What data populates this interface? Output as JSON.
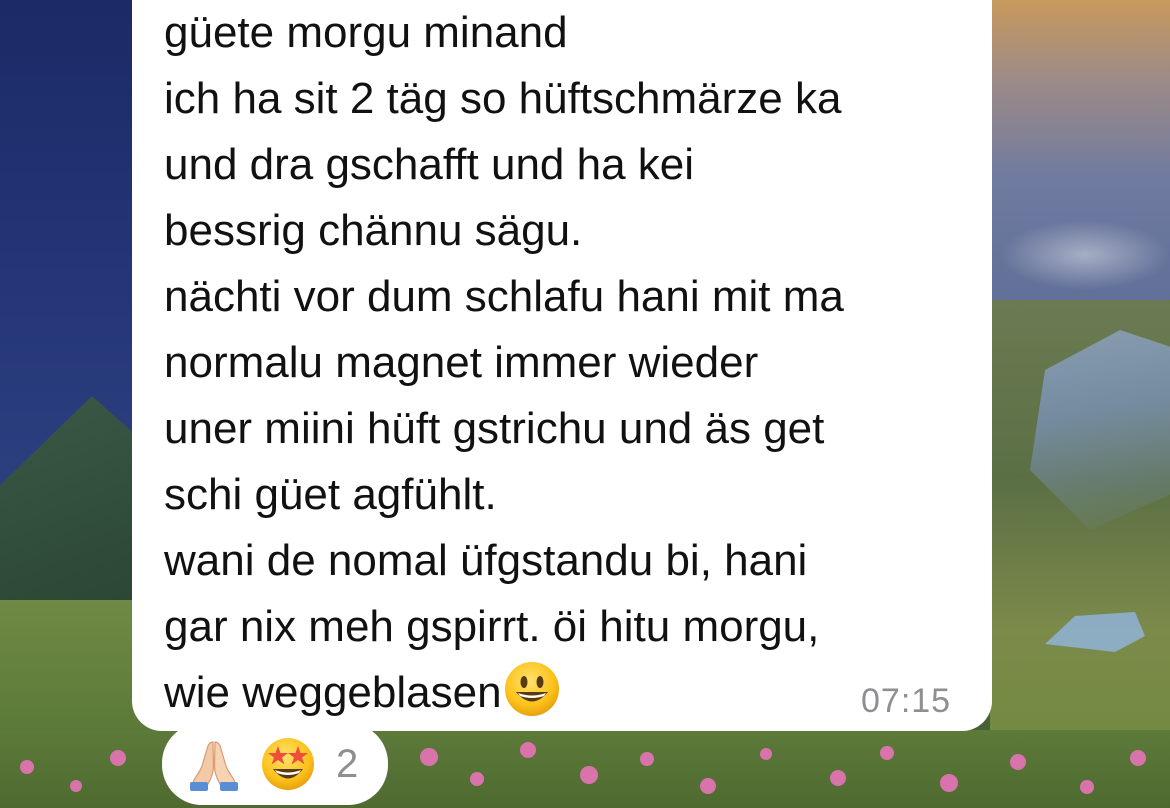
{
  "message": {
    "lines": [
      "güete morgu minand",
      "ich ha sit 2 täg so hüftschmärze ka",
      "und dra gschafft und ha kei",
      "bessrig chännu sägu.",
      "nächti vor dum schlafu hani mit ma",
      "normalu magnet immer wieder",
      "uner miini hüft gstrichu und äs get",
      "schi güet agfühlt.",
      "wani de nomal üfgstandu bi, hani",
      "gar nix meh gspirrt. öi hitu morgu,",
      "wie weggeblasen"
    ],
    "trailing_emoji": "grinning-face-icon",
    "timestamp": "07:15"
  },
  "reactions": {
    "emojis": [
      "folded-hands-icon",
      "star-struck-icon"
    ],
    "count": "2"
  },
  "colors": {
    "bubble": "#ffffff",
    "text": "#111111",
    "timestamp": "#8e8e93",
    "reaction_count": "#8e8e93"
  }
}
